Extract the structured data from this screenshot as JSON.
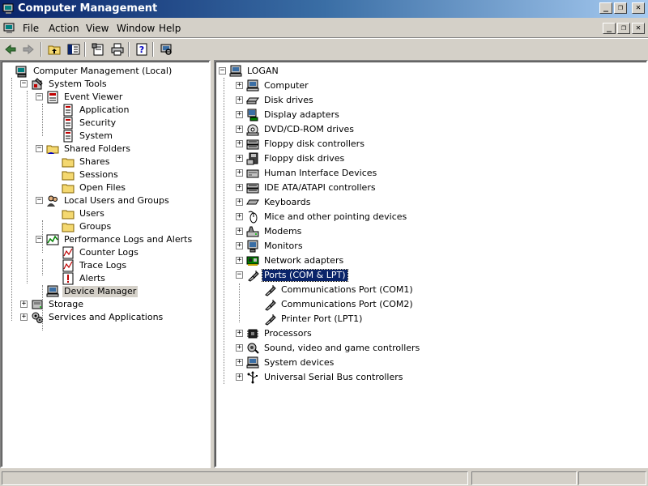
{
  "window": {
    "title": "Computer Management",
    "controls": {
      "minimize": "_",
      "restore": "❐",
      "close": "✕"
    }
  },
  "menubar": {
    "items": [
      "File",
      "Action",
      "View",
      "Window",
      "Help"
    ]
  },
  "left_tree": [
    {
      "label": "Computer Management (Local)",
      "icon": "computer-management-icon"
    },
    {
      "label": "System Tools",
      "icon": "system-tools-icon"
    },
    {
      "label": "Event Viewer",
      "icon": "event-viewer-icon"
    },
    {
      "label": "Application",
      "icon": "event-log-icon"
    },
    {
      "label": "Security",
      "icon": "event-log-icon"
    },
    {
      "label": "System",
      "icon": "event-log-icon"
    },
    {
      "label": "Shared Folders",
      "icon": "shared-folders-icon"
    },
    {
      "label": "Shares",
      "icon": "folder-icon"
    },
    {
      "label": "Sessions",
      "icon": "folder-icon"
    },
    {
      "label": "Open Files",
      "icon": "folder-icon"
    },
    {
      "label": "Local Users and Groups",
      "icon": "users-groups-icon"
    },
    {
      "label": "Users",
      "icon": "folder-icon"
    },
    {
      "label": "Groups",
      "icon": "folder-icon"
    },
    {
      "label": "Performance Logs and Alerts",
      "icon": "performance-icon"
    },
    {
      "label": "Counter Logs",
      "icon": "log-icon"
    },
    {
      "label": "Trace Logs",
      "icon": "log-icon"
    },
    {
      "label": "Alerts",
      "icon": "alert-icon"
    },
    {
      "label": "Device Manager",
      "icon": "device-manager-icon"
    },
    {
      "label": "Storage",
      "icon": "storage-icon"
    },
    {
      "label": "Services and Applications",
      "icon": "services-icon"
    }
  ],
  "right_tree": [
    {
      "label": "LOGAN",
      "icon": "computer-icon"
    },
    {
      "label": "Computer",
      "icon": "computer-icon"
    },
    {
      "label": "Disk drives",
      "icon": "disk-drive-icon"
    },
    {
      "label": "Display adapters",
      "icon": "display-adapter-icon"
    },
    {
      "label": "DVD/CD-ROM drives",
      "icon": "cdrom-icon"
    },
    {
      "label": "Floppy disk controllers",
      "icon": "controller-icon"
    },
    {
      "label": "Floppy disk drives",
      "icon": "floppy-icon"
    },
    {
      "label": "Human Interface Devices",
      "icon": "hid-icon"
    },
    {
      "label": "IDE ATA/ATAPI controllers",
      "icon": "controller-icon"
    },
    {
      "label": "Keyboards",
      "icon": "keyboard-icon"
    },
    {
      "label": "Mice and other pointing devices",
      "icon": "mouse-icon"
    },
    {
      "label": "Modems",
      "icon": "modem-icon"
    },
    {
      "label": "Monitors",
      "icon": "monitor-icon"
    },
    {
      "label": "Network adapters",
      "icon": "network-adapter-icon"
    },
    {
      "label": "Ports (COM & LPT)",
      "icon": "port-icon"
    },
    {
      "label": "Communications Port (COM1)",
      "icon": "port-icon"
    },
    {
      "label": "Communications Port (COM2)",
      "icon": "port-icon"
    },
    {
      "label": "Printer Port (LPT1)",
      "icon": "port-icon"
    },
    {
      "label": "Processors",
      "icon": "processor-icon"
    },
    {
      "label": "Sound, video and game controllers",
      "icon": "sound-icon"
    },
    {
      "label": "System devices",
      "icon": "system-devices-icon"
    },
    {
      "label": "Universal Serial Bus controllers",
      "icon": "usb-icon"
    }
  ],
  "colors": {
    "title_gradient_start": "#0a246a",
    "title_gradient_end": "#a6caf0",
    "selection": "#0a246a",
    "chrome": "#d4d0c8"
  }
}
